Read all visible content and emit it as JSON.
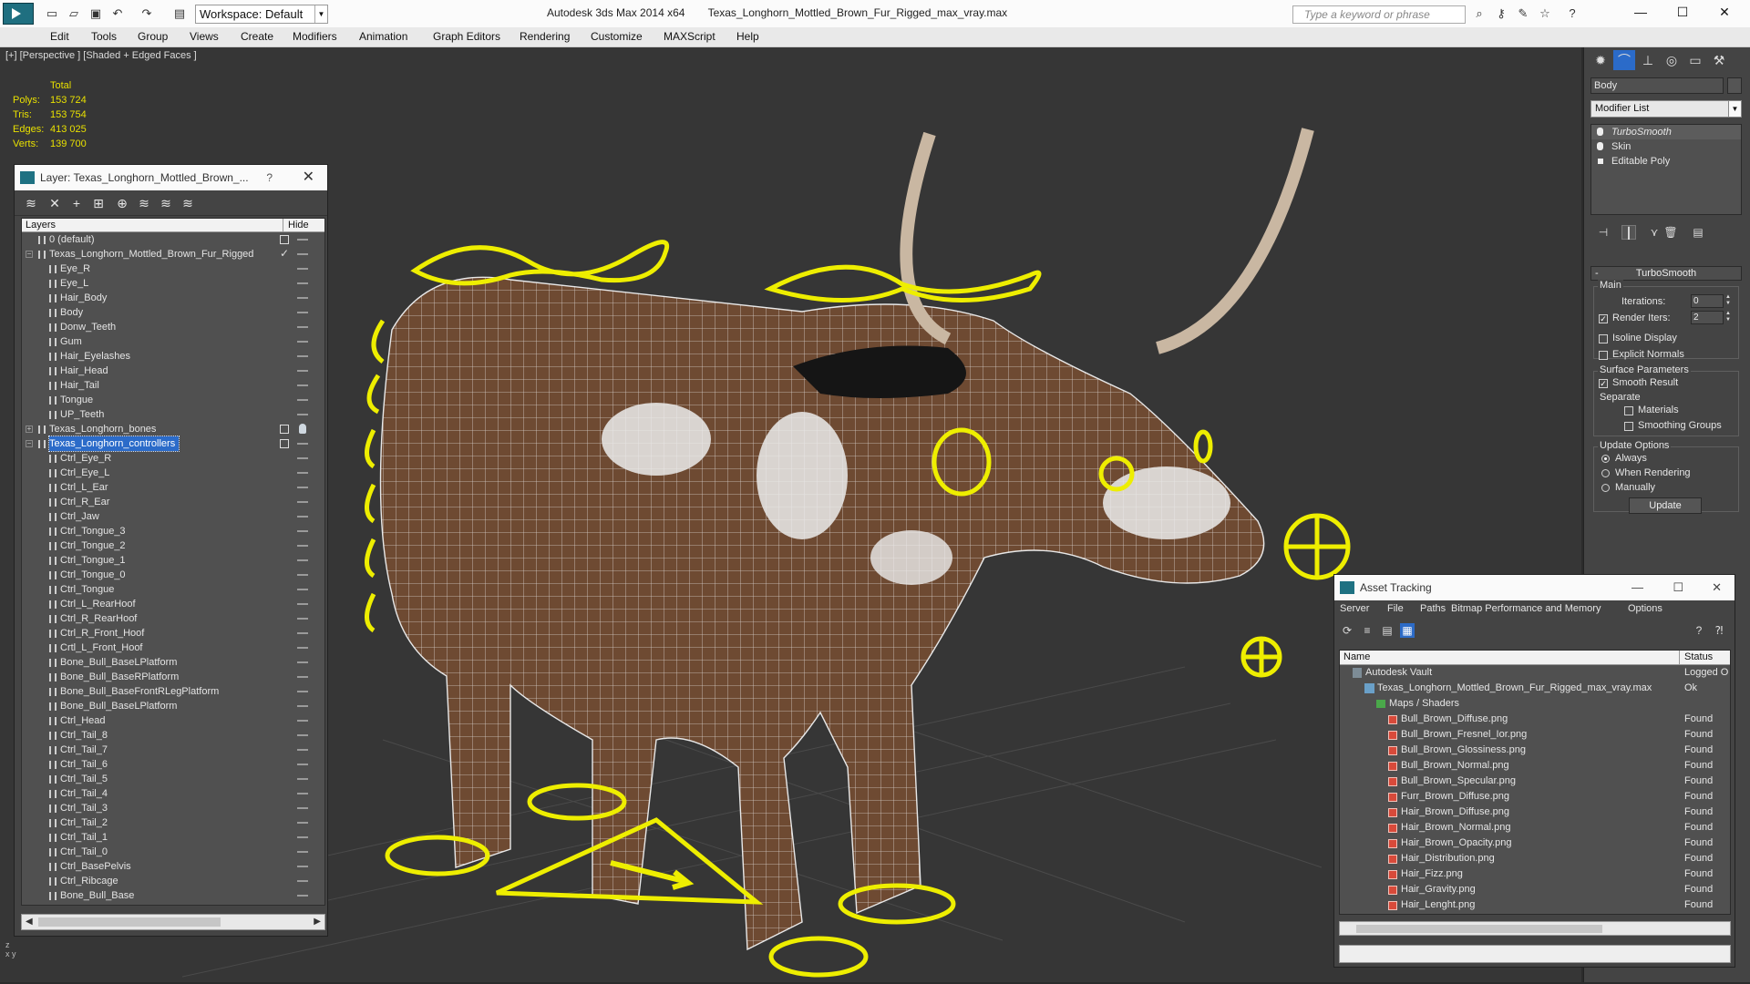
{
  "titlebar": {
    "workspace": "Workspace: Default",
    "app_name": "Autodesk 3ds Max  2014 x64",
    "file_name": "Texas_Longhorn_Mottled_Brown_Fur_Rigged_max_vray.max",
    "search_placeholder": "Type a keyword or phrase",
    "min_glyph": "—",
    "max_glyph": "☐",
    "close_glyph": "✕"
  },
  "menu": [
    "Edit",
    "Tools",
    "Group",
    "Views",
    "Create",
    "Modifiers",
    "Animation",
    "Graph Editors",
    "Rendering",
    "Customize",
    "MAXScript",
    "Help"
  ],
  "viewport": {
    "label": "[+] [Perspective ] [Shaded + Edged Faces ]",
    "stats": {
      "header": "Total",
      "rows": [
        {
          "k": "Polys:",
          "v": "153 724"
        },
        {
          "k": "Tris:",
          "v": "153 754"
        },
        {
          "k": "Edges:",
          "v": "413 025"
        },
        {
          "k": "Verts:",
          "v": "139 700"
        }
      ]
    },
    "wire_color": "#e8e800"
  },
  "layer_panel": {
    "title": "Layer: Texas_Longhorn_Mottled_Brown_...",
    "help": "?",
    "close": "✕",
    "col_layers": "Layers",
    "col_hide": "Hide",
    "rows": [
      {
        "name": "0 (default)",
        "level": 0,
        "type": "layer",
        "box": true
      },
      {
        "name": "Texas_Longhorn_Mottled_Brown_Fur_Rigged",
        "level": 0,
        "type": "layer",
        "exp": "−",
        "check": true
      },
      {
        "name": "Eye_R",
        "level": 1
      },
      {
        "name": "Eye_L",
        "level": 1
      },
      {
        "name": "Hair_Body",
        "level": 1
      },
      {
        "name": "Body",
        "level": 1
      },
      {
        "name": "Donw_Teeth",
        "level": 1
      },
      {
        "name": "Gum",
        "level": 1
      },
      {
        "name": "Hair_Eyelashes",
        "level": 1
      },
      {
        "name": "Hair_Head",
        "level": 1
      },
      {
        "name": "Hair_Tail",
        "level": 1
      },
      {
        "name": "Tongue",
        "level": 1
      },
      {
        "name": "UP_Teeth",
        "level": 1
      },
      {
        "name": "Texas_Longhorn_bones",
        "level": 0,
        "type": "layer",
        "exp": "+",
        "box": true,
        "bulb": true
      },
      {
        "name": "Texas_Longhorn_controllers",
        "level": 0,
        "type": "layer",
        "exp": "−",
        "box": true,
        "selected": true
      },
      {
        "name": "Ctrl_Eye_R",
        "level": 1
      },
      {
        "name": "Ctrl_Eye_L",
        "level": 1
      },
      {
        "name": "Ctrl_L_Ear",
        "level": 1
      },
      {
        "name": "Ctrl_R_Ear",
        "level": 1
      },
      {
        "name": "Ctrl_Jaw",
        "level": 1
      },
      {
        "name": "Ctrl_Tongue_3",
        "level": 1
      },
      {
        "name": "Ctrl_Tongue_2",
        "level": 1
      },
      {
        "name": "Ctrl_Tongue_1",
        "level": 1
      },
      {
        "name": "Ctrl_Tongue_0",
        "level": 1
      },
      {
        "name": "Ctrl_Tongue",
        "level": 1
      },
      {
        "name": "Ctrl_L_RearHoof",
        "level": 1
      },
      {
        "name": "Ctrl_R_RearHoof",
        "level": 1
      },
      {
        "name": "Ctrl_R_Front_Hoof",
        "level": 1
      },
      {
        "name": "Crtl_L_Front_Hoof",
        "level": 1
      },
      {
        "name": "Bone_Bull_BaseLPlatform",
        "level": 1
      },
      {
        "name": "Bone_Bull_BaseRPlatform",
        "level": 1
      },
      {
        "name": "Bone_Bull_BaseFrontRLegPlatform",
        "level": 1
      },
      {
        "name": "Bone_Bull_BaseLPlatform",
        "level": 1
      },
      {
        "name": "Ctrl_Head",
        "level": 1
      },
      {
        "name": "Ctrl_Tail_8",
        "level": 1
      },
      {
        "name": "Ctrl_Tail_7",
        "level": 1
      },
      {
        "name": "Ctrl_Tail_6",
        "level": 1
      },
      {
        "name": "Ctrl_Tail_5",
        "level": 1
      },
      {
        "name": "Ctrl_Tail_4",
        "level": 1
      },
      {
        "name": "Ctrl_Tail_3",
        "level": 1
      },
      {
        "name": "Ctrl_Tail_2",
        "level": 1
      },
      {
        "name": "Ctrl_Tail_1",
        "level": 1
      },
      {
        "name": "Ctrl_Tail_0",
        "level": 1
      },
      {
        "name": "Ctrl_BasePelvis",
        "level": 1
      },
      {
        "name": "Ctrl_Ribcage",
        "level": 1
      },
      {
        "name": "Bone_Bull_Base",
        "level": 1
      }
    ]
  },
  "command_panel": {
    "object_name": "Body",
    "modifier_list": "Modifier List",
    "stack": [
      {
        "name": "TurboSmooth",
        "selected": true,
        "icon": "bulb"
      },
      {
        "name": "Skin",
        "icon": "bulb"
      },
      {
        "name": "Editable Poly",
        "icon": "square"
      }
    ],
    "turbosmooth": {
      "title": "TurboSmooth",
      "collapse": "-",
      "main": "Main",
      "iterations_label": "Iterations:",
      "iterations_value": "0",
      "render_iters_label": "Render Iters:",
      "render_iters_value": "2",
      "render_iters_checked": true,
      "isoline": "Isoline Display",
      "explicit_normals": "Explicit Normals",
      "surface_params": "Surface Parameters",
      "smooth_result": "Smooth Result",
      "separate": "Separate",
      "materials": "Materials",
      "smoothing_groups": "Smoothing Groups",
      "update_options": "Update Options",
      "always": "Always",
      "when_rendering": "When Rendering",
      "manually": "Manually",
      "update_btn": "Update"
    }
  },
  "asset_tracking": {
    "title": "Asset Tracking",
    "menu": [
      "Server",
      "File",
      "Paths",
      "Bitmap Performance and Memory",
      "Options"
    ],
    "col_name": "Name",
    "col_status": "Status",
    "rows": [
      {
        "name": "Autodesk Vault",
        "status": "Logged O",
        "icon": "vault",
        "indent": 0
      },
      {
        "name": "Texas_Longhorn_Mottled_Brown_Fur_Rigged_max_vray.max",
        "status": "Ok",
        "icon": "max",
        "indent": 1
      },
      {
        "name": "Maps / Shaders",
        "status": "",
        "icon": "folder",
        "indent": 2
      },
      {
        "name": "Bull_Brown_Diffuse.png",
        "status": "Found",
        "icon": "png",
        "indent": 3
      },
      {
        "name": "Bull_Brown_Fresnel_Ior.png",
        "status": "Found",
        "icon": "png",
        "indent": 3
      },
      {
        "name": "Bull_Brown_Glossiness.png",
        "status": "Found",
        "icon": "png",
        "indent": 3
      },
      {
        "name": "Bull_Brown_Normal.png",
        "status": "Found",
        "icon": "png",
        "indent": 3
      },
      {
        "name": "Bull_Brown_Specular.png",
        "status": "Found",
        "icon": "png",
        "indent": 3
      },
      {
        "name": "Furr_Brown_Diffuse.png",
        "status": "Found",
        "icon": "png",
        "indent": 3
      },
      {
        "name": "Hair_Brown_Diffuse.png",
        "status": "Found",
        "icon": "png",
        "indent": 3
      },
      {
        "name": "Hair_Brown_Normal.png",
        "status": "Found",
        "icon": "png",
        "indent": 3
      },
      {
        "name": "Hair_Brown_Opacity.png",
        "status": "Found",
        "icon": "png",
        "indent": 3
      },
      {
        "name": "Hair_Distribution.png",
        "status": "Found",
        "icon": "png",
        "indent": 3
      },
      {
        "name": "Hair_Fizz.png",
        "status": "Found",
        "icon": "png",
        "indent": 3
      },
      {
        "name": "Hair_Gravity.png",
        "status": "Found",
        "icon": "png",
        "indent": 3
      },
      {
        "name": "Hair_Lenght.png",
        "status": "Found",
        "icon": "png",
        "indent": 3
      }
    ]
  }
}
